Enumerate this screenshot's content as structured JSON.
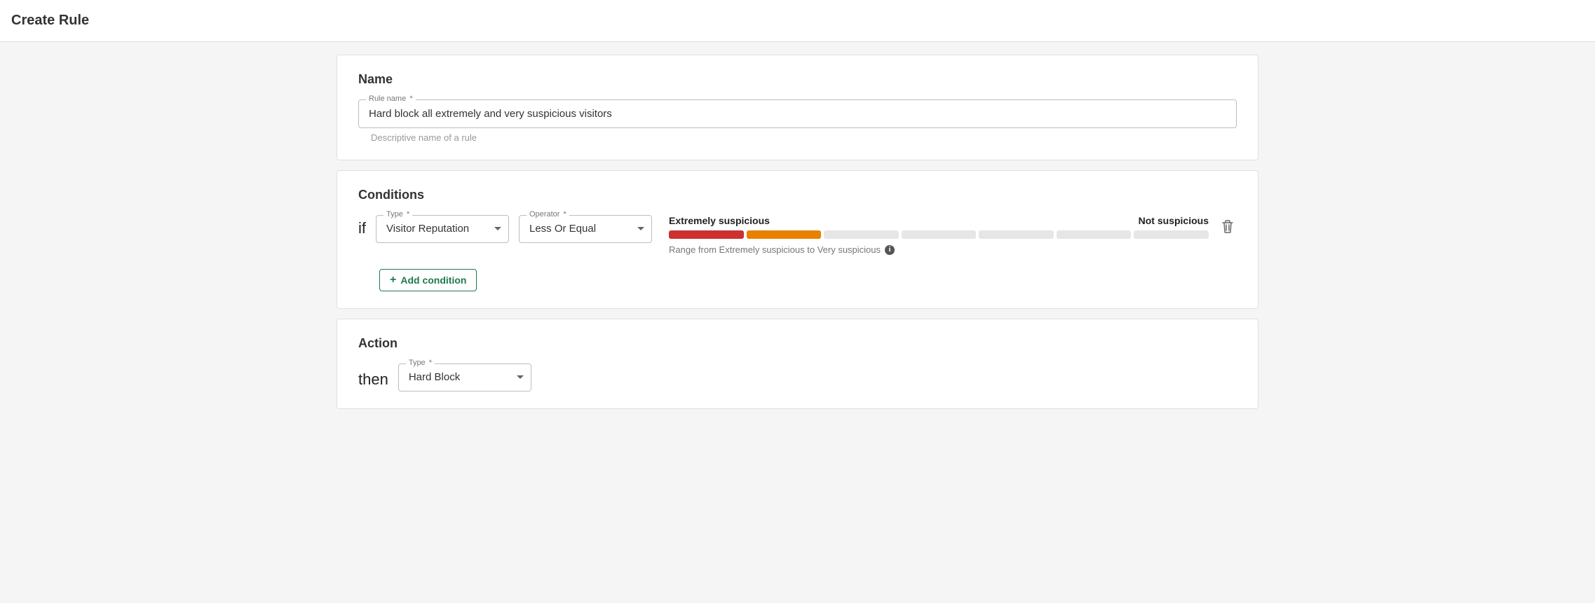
{
  "page_title": "Create Rule",
  "name_section": {
    "heading": "Name",
    "field_label": "Rule name",
    "required_mark": "*",
    "value": "Hard block all extremely and very suspicious visitors",
    "helper": "Descriptive name of a rule"
  },
  "conditions_section": {
    "heading": "Conditions",
    "if_keyword": "if",
    "type_label": "Type",
    "type_value": "Visitor Reputation",
    "operator_label": "Operator",
    "operator_value": "Less Or Equal",
    "required_mark": "*",
    "reputation": {
      "left_label": "Extremely suspicious",
      "right_label": "Not suspicious",
      "range_text": "Range from Extremely suspicious to Very suspicious",
      "segments": 7,
      "active_colors": [
        "red",
        "orange"
      ]
    },
    "add_button_label": "Add condition"
  },
  "action_section": {
    "heading": "Action",
    "then_keyword": "then",
    "type_label": "Type",
    "required_mark": "*",
    "type_value": "Hard Block"
  }
}
